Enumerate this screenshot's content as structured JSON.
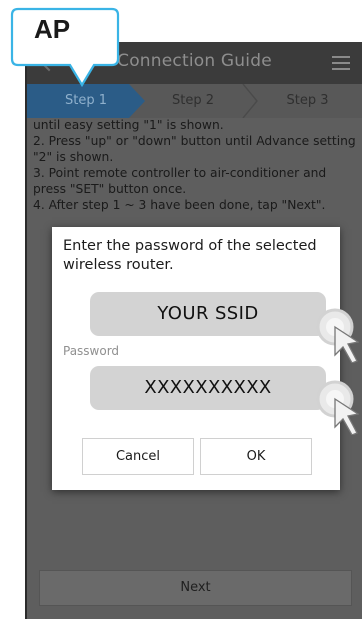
{
  "app": {
    "title": "Connection Guide",
    "mode_badge": "AP"
  },
  "steps": [
    {
      "label": "Step 1",
      "active": true
    },
    {
      "label": "Step 2",
      "active": false
    },
    {
      "label": "Step 3",
      "active": false
    }
  ],
  "instructions": {
    "line1": "until easy setting \"1\" is shown.",
    "line2": "2. Press \"up\" or \"down\" button until Advance setting \"2\" is shown.",
    "line3": "3. Point remote controller to air-conditioner and press \"SET\" button once.",
    "line4": "4. After step 1 ~ 3 have been done, tap \"Next\"."
  },
  "dialog": {
    "message": "Enter the password of the selected wireless router.",
    "ssid_value": "YOUR SSID",
    "password_label": "Password",
    "password_value": "XXXXXXXXXX",
    "cancel_label": "Cancel",
    "ok_label": "OK"
  },
  "footer": {
    "next_label": "Next"
  },
  "icons": {
    "back": "chevron-left-icon",
    "menu": "hamburger-menu-icon",
    "tap_hint": "tap-pointer-icon"
  },
  "colors": {
    "active_step": "#2b5c87",
    "badge_border": "#3ab4e6",
    "overlay": "#5e5e5e"
  }
}
